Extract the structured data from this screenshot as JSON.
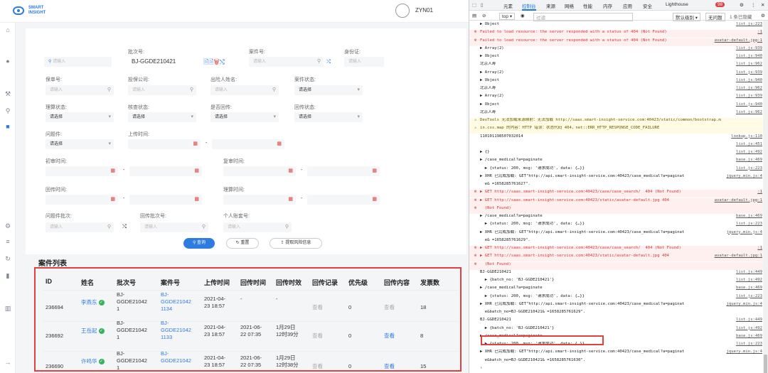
{
  "app": {
    "logo_line1": "SMART",
    "logo_line2": "INSIGHT",
    "username": "ZYN01"
  },
  "filters": {
    "search_placeholder": "请输入",
    "batch_label": "批次号:",
    "batch_value": "BJ-GGDE210421",
    "case_no_label": "案件号:",
    "case_no_placeholder": "请输入",
    "id_label": "身份证:",
    "id_placeholder": "请输入",
    "policy_label": "保单号:",
    "policy_placeholder": "请输入",
    "insurer_label": "投保公司:",
    "insurer_placeholder": "请输入",
    "insured_label": "出险人姓名:",
    "insured_placeholder": "请输入",
    "case_status_label": "案件状态:",
    "select_placeholder": "请选择",
    "claim_status_label": "理算状态:",
    "audit_status_label": "核查状态:",
    "return_label": "是否回传:",
    "return_status_label": "回传状态:",
    "problem_label": "问题件:",
    "upload_time_label": "上传时间:",
    "first_review_label": "初审时间:",
    "second_review_label": "复审时间:",
    "return_time_label": "回传时间:",
    "settle_time_label": "理算时间:",
    "problem_batch_label": "问题件批次:",
    "return_batch_label": "回传批次号:",
    "account_label": "个人账套号:",
    "dash": "-"
  },
  "buttons": {
    "query": "查询",
    "reset": "重置",
    "export": "提取风险信息"
  },
  "table": {
    "title": "案件列表",
    "headers": [
      "ID",
      "姓名",
      "批次号",
      "案件号",
      "上传时间",
      "回传时间",
      "回传时效",
      "回传记录",
      "优先级",
      "回传内容",
      "发票数"
    ],
    "rows": [
      {
        "id": "236694",
        "name": "李燕东",
        "batch": [
          "BJ-",
          "GGDE21042",
          "1"
        ],
        "case": [
          "BJ-",
          "GGDE21042",
          "1134"
        ],
        "upload": [
          "2021-04-",
          "23 18:57"
        ],
        "ret_time": [
          "-"
        ],
        "ret_eff": [
          "-"
        ],
        "record": "查看",
        "priority": "0",
        "content": "查看",
        "invoices": "18"
      },
      {
        "id": "236692",
        "name": "王岳起",
        "batch": [
          "BJ-",
          "GGDE21042",
          "1"
        ],
        "case": [
          "BJ-",
          "GGDE21042",
          "1133"
        ],
        "upload": [
          "2021-04-",
          "23 18:57"
        ],
        "ret_time": [
          "2021-06-",
          "22 07:35"
        ],
        "ret_eff": [
          "1月29日",
          "12时39分"
        ],
        "record": "查看",
        "priority": "0",
        "content": "查看",
        "invoices": "8"
      },
      {
        "id": "236690",
        "name": "许鸣华",
        "batch": [
          "BJ-",
          "GGDE21042",
          "1"
        ],
        "case": [
          "BJ-",
          "GGDE21042",
          ""
        ],
        "upload": [
          "2021-04-",
          "23 18:57"
        ],
        "ret_time": [
          "2021-06-",
          "22 07:35"
        ],
        "ret_eff": [
          "1月29日",
          "12时38分"
        ],
        "record": "查看",
        "priority": "0",
        "content": "查看",
        "invoices": "15"
      }
    ]
  },
  "devtools": {
    "tabs": [
      "元素",
      "控制台",
      "来源",
      "网络",
      "性能",
      "内存",
      "应用",
      "安全",
      "Lighthouse"
    ],
    "error_count": "98",
    "toolbar": {
      "context": "top ▾",
      "filter": "过滤",
      "levels": "默认级别 ▾",
      "issues": "无问题",
      "hidden": "1 条已隐藏"
    },
    "logs": [
      {
        "type": "info",
        "text": "▶ Object",
        "src": "list.js:223"
      },
      {
        "type": "err",
        "text": "Failed to load resource: the server responded with a status of 404 (Not Found)",
        "src": ":1"
      },
      {
        "type": "err",
        "text": "Failed to load resource: the server responded with a status of 404 (Not Found)",
        "src": "avatar-default.jpg:1"
      },
      {
        "type": "info",
        "text": "▶ Array(2)",
        "src": "list.js:939"
      },
      {
        "type": "info",
        "text": "▶ Object",
        "src": "list.js:940"
      },
      {
        "type": "info",
        "text": "北京人寿",
        "src": "list.js:962"
      },
      {
        "type": "info",
        "text": "▶ Array(2)",
        "src": "list.js:939"
      },
      {
        "type": "info",
        "text": "▶ Object",
        "src": "list.js:940"
      },
      {
        "type": "info",
        "text": "北京人寿",
        "src": "list.js:962"
      },
      {
        "type": "info",
        "text": "▶ Array(2)",
        "src": "list.js:939"
      },
      {
        "type": "info",
        "text": "▶ Object",
        "src": "list.js:940"
      },
      {
        "type": "info",
        "text": "北京人寿",
        "src": "list.js:962"
      },
      {
        "type": "warn",
        "text": "DevTools 无法加载来源映射：无法加载 http://saas.smart-insight-service.com:40423/static/common/bootstrap.m",
        "src": ""
      },
      {
        "type": "warn",
        "text": "in.css.map 的内容：HTTP 错误：状态代码 404，net::ERR_HTTP_RESPONSE_CODE_FAILURE",
        "src": ""
      },
      {
        "type": "info",
        "text": "110101198507032014",
        "src": "lookup.js:110"
      },
      {
        "type": "info",
        "text": "",
        "src": "list.js:451"
      },
      {
        "type": "info",
        "text": "▶ {}",
        "src": "list.js:492"
      },
      {
        "type": "info",
        "text": "▶ /case_medical?a=paginate",
        "src": "base.js:469"
      },
      {
        "type": "info",
        "text": "  ▶ {status: 200, msg: '请求成功', data: {…}}",
        "src": "list.js:223"
      },
      {
        "type": "info",
        "text": "▶ XHR 已完成加载: GET\"http://api.smart-insight-service.com:40423/case_medical?a=paginat",
        "src": "jquery.min.js:4"
      },
      {
        "type": "info",
        "text": "  e& =1658285761627\".",
        "src": ""
      },
      {
        "type": "err",
        "text": "▶ GET http://saas.smart-insight-service.com:40423/case/case_search/  404 (Not Found)",
        "src": ":1"
      },
      {
        "type": "err",
        "text": "▶ GET http://saas.smart-insight-service.com:40423/static/avatar-default.jpg 404",
        "src": "avatar-default.jpg:1"
      },
      {
        "type": "err",
        "text": "  (Not Found)",
        "src": ""
      },
      {
        "type": "info",
        "text": "▶ /case_medical?a=paginate",
        "src": "base.js:469"
      },
      {
        "type": "info",
        "text": "  ▶ {status: 200, msg: '请求成功', data: {…}}",
        "src": "list.js:223"
      },
      {
        "type": "info",
        "text": "▶ XHR 已完成加载: GET\"http://api.smart-insight-service.com:40423/case_medical?a=paginat",
        "src": "jquery.min.js:4"
      },
      {
        "type": "info",
        "text": "  e& =1658285761629\".",
        "src": ""
      },
      {
        "type": "err",
        "text": "▶ GET http://saas.smart-insight-service.com:40423/case/case_search/  404 (Not Found)",
        "src": ":1"
      },
      {
        "type": "err",
        "text": "▶ GET http://saas.smart-insight-service.com:40423/static/avatar-default.jpg 404",
        "src": "avatar-default.jpg:1"
      },
      {
        "type": "err",
        "text": "  (Not Found)",
        "src": ""
      },
      {
        "type": "info",
        "text": "BJ-GGDE210421",
        "src": "list.js:449"
      },
      {
        "type": "info",
        "text": "  ▶ {batch_no: 'BJ-GGDE210421'}",
        "src": "list.js:492"
      },
      {
        "type": "info",
        "text": "▶ /case_medical?a=paginate",
        "src": "base.js:469"
      },
      {
        "type": "info",
        "text": "  ▶ {status: 200, msg: '请求成功', data: {…}}",
        "src": "list.js:223"
      },
      {
        "type": "info",
        "text": "▶ XHR 已完成加载: GET\"http://api.smart-insight-service.com:40423/case_medical?a=paginat",
        "src": "jquery.min.js:4"
      },
      {
        "type": "info",
        "text": "  e&batch_no=BJ-GGDE210421& =1658285761629\".",
        "src": ""
      },
      {
        "type": "info",
        "text": "BJ-GGDE210421",
        "src": "list.js:449"
      },
      {
        "type": "info",
        "text": "  ▶ {batch_no: 'BJ-GGDE210421'}",
        "src": "list.js:492"
      },
      {
        "type": "info",
        "text": "▶ /case_medical?a=paginate",
        "src": "base.js:469"
      },
      {
        "type": "info",
        "text": "  ▶ {status: 200, msg: '请求成功', data: {…}}",
        "src": "list.js:223"
      },
      {
        "type": "info",
        "text": "▶ XHR 已完成加载: GET\"http://api.smart-insight-service.com:40423/case_medical?a=paginat",
        "src": "jquery.min.js:4"
      },
      {
        "type": "info",
        "text": "  e&batch_no=BJ-GGDE210421& =1658285761630\".",
        "src": ""
      },
      {
        "type": "info",
        "text": "›",
        "src": ""
      }
    ]
  }
}
